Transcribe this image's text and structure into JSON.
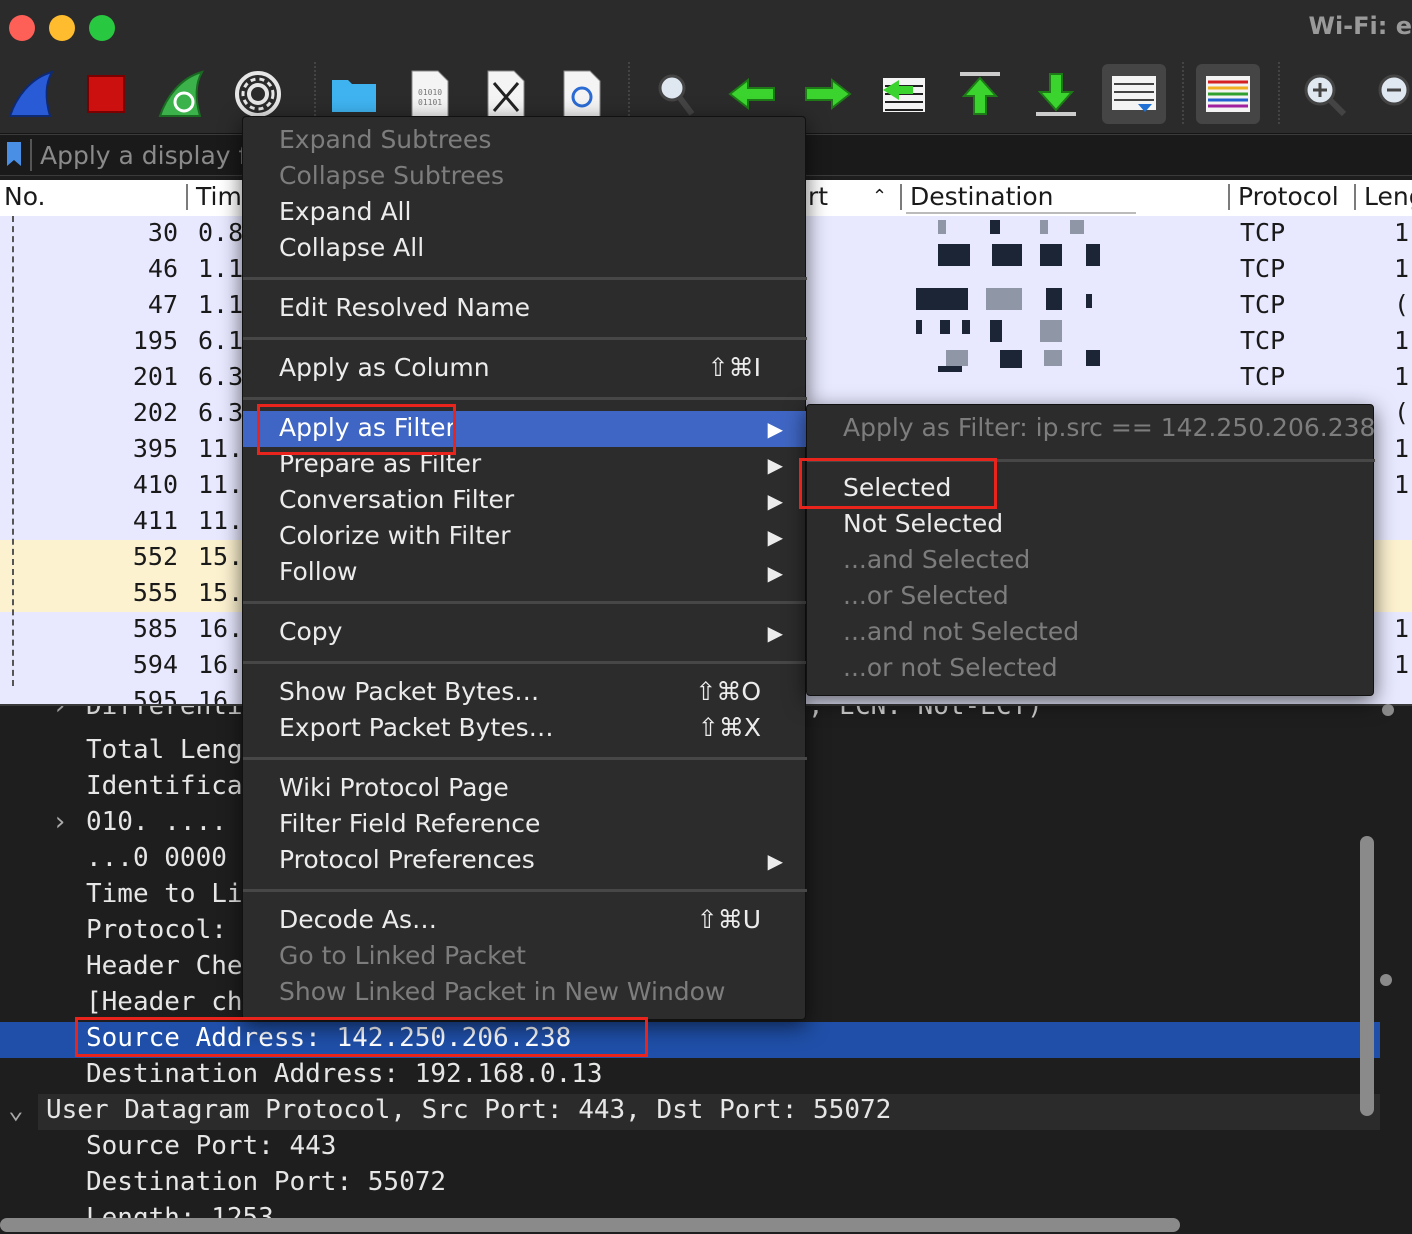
{
  "window": {
    "title": "Wi-Fi: e",
    "toolbar_tooltips": [
      "start-capture",
      "stop-capture",
      "restart-capture",
      "capture-options",
      "open-file",
      "save-file",
      "close-file",
      "reload-file",
      "find-packet",
      "go-back",
      "go-forward",
      "go-to-packet",
      "go-first",
      "go-last",
      "auto-scroll",
      "colorize",
      "zoom-in",
      "zoom-out"
    ]
  },
  "filter_bar": {
    "placeholder": "Apply a display fi"
  },
  "packet_list": {
    "columns": [
      "No.",
      "Tim",
      "rt",
      "Destination",
      "Protocol",
      "Leng"
    ],
    "rows": [
      {
        "no": "30",
        "time": "0.8",
        "protocol": "TCP",
        "len": "1",
        "bg": "#e8e9ff"
      },
      {
        "no": "46",
        "time": "1.1",
        "protocol": "TCP",
        "len": "1",
        "bg": "#e8e9ff"
      },
      {
        "no": "47",
        "time": "1.1",
        "protocol": "TCP",
        "len": "(",
        "bg": "#e8e9ff"
      },
      {
        "no": "195",
        "time": "6.1",
        "protocol": "TCP",
        "len": "1",
        "bg": "#e8e9ff"
      },
      {
        "no": "201",
        "time": "6.3",
        "protocol": "TCP",
        "len": "1",
        "bg": "#e8e9ff"
      },
      {
        "no": "202",
        "time": "6.3",
        "protocol": "",
        "len": "(",
        "bg": "#e8e9ff"
      },
      {
        "no": "395",
        "time": "11.",
        "protocol": "",
        "len": "1",
        "bg": "#e8e9ff"
      },
      {
        "no": "410",
        "time": "11.",
        "protocol": "",
        "len": "1",
        "bg": "#e8e9ff"
      },
      {
        "no": "411",
        "time": "11.",
        "protocol": "",
        "len": "",
        "bg": "#e8e9ff"
      },
      {
        "no": "552",
        "time": "15.",
        "protocol": "",
        "len": "",
        "bg": "#fdf2d0"
      },
      {
        "no": "555",
        "time": "15.",
        "protocol": "",
        "len": "",
        "bg": "#fdf2d0"
      },
      {
        "no": "585",
        "time": "16.",
        "protocol": "",
        "len": "1",
        "bg": "#e8e9ff"
      },
      {
        "no": "594",
        "time": "16.",
        "protocol": "",
        "len": "1",
        "bg": "#e8e9ff"
      },
      {
        "no": "595",
        "time": "16.",
        "protocol": "",
        "len": "",
        "bg": "#e8e9ff"
      }
    ]
  },
  "details": {
    "rows": [
      {
        "text": "Total Leng",
        "indent": 86,
        "arrow": ""
      },
      {
        "text": "Identifica",
        "indent": 86,
        "arrow": ""
      },
      {
        "text": "010. ....",
        "indent": 86,
        "arrow": "›"
      },
      {
        "text": "...0 0000",
        "indent": 86,
        "arrow": ""
      },
      {
        "text": "Time to Li",
        "indent": 86,
        "arrow": ""
      },
      {
        "text": "Protocol: ",
        "indent": 86,
        "arrow": ""
      },
      {
        "text": "Header Che",
        "indent": 86,
        "arrow": ""
      },
      {
        "text": "[Header ch",
        "indent": 86,
        "arrow": ""
      },
      {
        "text": "Source Address: 142.250.206.238",
        "indent": 86,
        "arrow": "",
        "selected": true
      },
      {
        "text": "Destination Address: 192.168.0.13",
        "indent": 86,
        "arrow": ""
      },
      {
        "text": "User Datagram Protocol, Src Port: 443, Dst Port: 55072",
        "indent": 46,
        "arrow": "⌄",
        "header": true
      },
      {
        "text": "Source Port: 443",
        "indent": 86,
        "arrow": ""
      },
      {
        "text": "Destination Port: 55072",
        "indent": 86,
        "arrow": ""
      },
      {
        "text": "Length: 1253",
        "indent": 86,
        "arrow": ""
      }
    ],
    "partial_top_text": "Differenti",
    "partial_right_text": ", ECN: Not-ECT)"
  },
  "context_menu": {
    "items": [
      {
        "label": "Expand Subtrees",
        "disabled": true
      },
      {
        "label": "Collapse Subtrees",
        "disabled": true
      },
      {
        "label": "Expand All"
      },
      {
        "label": "Collapse All"
      },
      {
        "sep": true
      },
      {
        "label": "Edit Resolved Name"
      },
      {
        "sep": true
      },
      {
        "label": "Apply as Column",
        "shortcut": "⇧⌘I"
      },
      {
        "sep": true
      },
      {
        "label": "Apply as Filter",
        "submenu": true,
        "highlighted": true
      },
      {
        "label": "Prepare as Filter",
        "submenu": true
      },
      {
        "label": "Conversation Filter",
        "submenu": true
      },
      {
        "label": "Colorize with Filter",
        "submenu": true
      },
      {
        "label": "Follow",
        "submenu": true
      },
      {
        "sep": true
      },
      {
        "label": "Copy",
        "submenu": true
      },
      {
        "sep": true
      },
      {
        "label": "Show Packet Bytes…",
        "shortcut": "⇧⌘O"
      },
      {
        "label": "Export Packet Bytes…",
        "shortcut": "⇧⌘X"
      },
      {
        "sep": true
      },
      {
        "label": "Wiki Protocol Page"
      },
      {
        "label": "Filter Field Reference"
      },
      {
        "label": "Protocol Preferences",
        "submenu": true
      },
      {
        "sep": true
      },
      {
        "label": "Decode As…",
        "shortcut": "⇧⌘U"
      },
      {
        "label": "Go to Linked Packet",
        "disabled": true
      },
      {
        "label": "Show Linked Packet in New Window",
        "disabled": true
      }
    ]
  },
  "submenu": {
    "header": "Apply as Filter: ip.src == 142.250.206.238",
    "items": [
      {
        "label": "Selected"
      },
      {
        "label": "Not Selected"
      },
      {
        "label": "...and Selected",
        "disabled": true
      },
      {
        "label": "...or Selected",
        "disabled": true
      },
      {
        "label": "...and not Selected",
        "disabled": true
      },
      {
        "label": "...or not Selected",
        "disabled": true
      }
    ]
  },
  "colors": {
    "highlight": "#3f66c4",
    "selected_row": "#1f4fa8",
    "annotation_red": "#e8241d"
  }
}
